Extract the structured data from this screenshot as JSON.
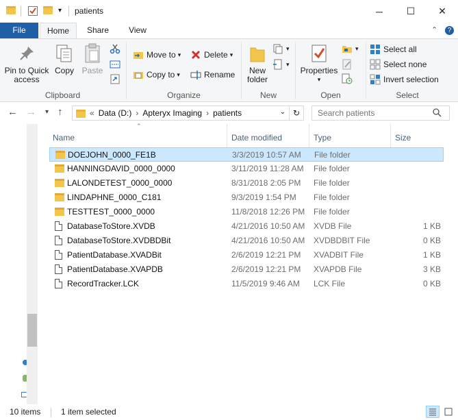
{
  "window": {
    "title": "patients",
    "minimize_glyph": "─",
    "maximize_glyph": "☐",
    "close_glyph": "✕"
  },
  "ribbon_tabs": {
    "file": "File",
    "home": "Home",
    "share": "Share",
    "view": "View"
  },
  "ribbon": {
    "clipboard": {
      "label": "Clipboard",
      "pin": "Pin to Quick access",
      "copy": "Copy",
      "paste": "Paste"
    },
    "organize": {
      "label": "Organize",
      "move_to": "Move to",
      "copy_to": "Copy to",
      "delete": "Delete",
      "rename": "Rename"
    },
    "new": {
      "label": "New",
      "new_folder": "New folder"
    },
    "open": {
      "label": "Open",
      "properties": "Properties"
    },
    "select": {
      "label": "Select",
      "select_all": "Select all",
      "select_none": "Select none",
      "invert": "Invert selection"
    }
  },
  "address": {
    "prefix": "«",
    "crumbs": [
      "Data (D:)",
      "Apteryx Imaging",
      "patients"
    ],
    "separator": "›",
    "search_placeholder": "Search patients"
  },
  "columns": {
    "name": "Name",
    "date": "Date modified",
    "type": "Type",
    "size": "Size"
  },
  "files": [
    {
      "name": "DOEJOHN_0000_FE1B",
      "date": "3/3/2019 10:57 AM",
      "type": "File folder",
      "size": "",
      "icon": "folder-icon",
      "selected": true
    },
    {
      "name": "HANNINGDAVID_0000_0000",
      "date": "3/11/2019 11:28 AM",
      "type": "File folder",
      "size": "",
      "icon": "folder-icon"
    },
    {
      "name": "LALONDETEST_0000_0000",
      "date": "8/31/2018 2:05 PM",
      "type": "File folder",
      "size": "",
      "icon": "folder-icon"
    },
    {
      "name": "LINDAPHNE_0000_C181",
      "date": "9/3/2019 1:54 PM",
      "type": "File folder",
      "size": "",
      "icon": "folder-icon"
    },
    {
      "name": "TESTTEST_0000_0000",
      "date": "11/8/2018 12:26 PM",
      "type": "File folder",
      "size": "",
      "icon": "folder-icon"
    },
    {
      "name": "DatabaseToStore.XVDB",
      "date": "4/21/2016 10:50 AM",
      "type": "XVDB File",
      "size": "1 KB",
      "icon": "file-icon"
    },
    {
      "name": "DatabaseToStore.XVDBDBit",
      "date": "4/21/2016 10:50 AM",
      "type": "XVDBDBIT File",
      "size": "0 KB",
      "icon": "file-icon"
    },
    {
      "name": "PatientDatabase.XVADBit",
      "date": "2/6/2019 12:21 PM",
      "type": "XVADBIT File",
      "size": "1 KB",
      "icon": "file-icon"
    },
    {
      "name": "PatientDatabase.XVAPDB",
      "date": "2/6/2019 12:21 PM",
      "type": "XVAPDB File",
      "size": "3 KB",
      "icon": "file-icon"
    },
    {
      "name": "RecordTracker.LCK",
      "date": "11/5/2019 9:46 AM",
      "type": "LCK File",
      "size": "0 KB",
      "icon": "file-icon"
    }
  ],
  "status": {
    "count": "10 items",
    "selection": "1 item selected"
  },
  "colors": {
    "file_tab": "#1f5fa8",
    "selection_bg": "#cce8ff",
    "selection_border": "#99d1ff",
    "folder": "#f3c64b"
  }
}
